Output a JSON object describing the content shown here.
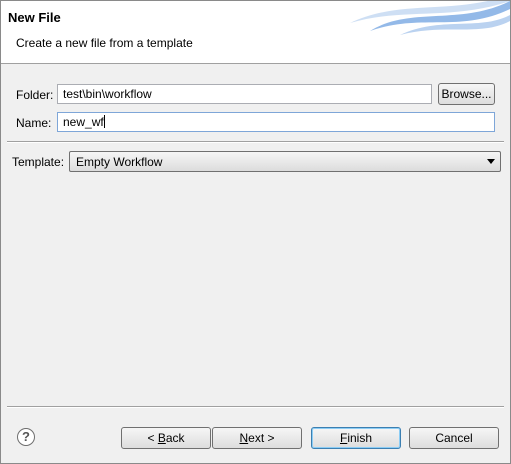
{
  "header": {
    "title": "New File",
    "description": "Create a new file from a template"
  },
  "form": {
    "folder_label": "Folder:",
    "folder_value": "test\\bin\\workflow",
    "browse_label": "Browse...",
    "name_label": "Name:",
    "name_value": "new_wf",
    "template_label": "Template:",
    "template_value": "Empty Workflow"
  },
  "footer": {
    "help_symbol": "?",
    "back_prefix": "< ",
    "back_mnemonic": "B",
    "back_rest": "ack",
    "next_mnemonic": "N",
    "next_rest": "ext >",
    "finish_mnemonic": "F",
    "finish_rest": "inish",
    "cancel_label": "Cancel"
  },
  "colors": {
    "banner_blue": "#3a7fd5",
    "default_button_border": "#3c7fb1"
  }
}
